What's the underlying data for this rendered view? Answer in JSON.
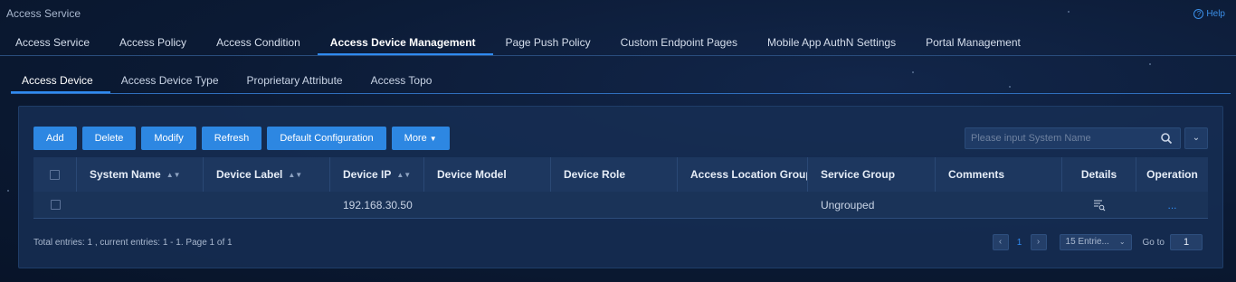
{
  "app": {
    "title": "Access Service",
    "help_label": "Help"
  },
  "main_tabs": [
    {
      "label": "Access Service"
    },
    {
      "label": "Access Policy"
    },
    {
      "label": "Access Condition"
    },
    {
      "label": "Access Device Management",
      "active": true
    },
    {
      "label": "Page Push Policy"
    },
    {
      "label": "Custom Endpoint Pages"
    },
    {
      "label": "Mobile App AuthN Settings"
    },
    {
      "label": "Portal Management"
    }
  ],
  "sub_tabs": [
    {
      "label": "Access Device",
      "active": true
    },
    {
      "label": "Access Device Type"
    },
    {
      "label": "Proprietary Attribute"
    },
    {
      "label": "Access Topo"
    }
  ],
  "toolbar": {
    "add": "Add",
    "delete": "Delete",
    "modify": "Modify",
    "refresh": "Refresh",
    "default_config": "Default Configuration",
    "more": "More"
  },
  "search": {
    "placeholder": "Please input System Name",
    "value": ""
  },
  "table": {
    "columns": [
      "System Name",
      "Device Label",
      "Device IP",
      "Device Model",
      "Device Role",
      "Access Location Group",
      "Service Group",
      "Comments",
      "Details",
      "Operation"
    ],
    "rows": [
      {
        "system_name": "",
        "device_label": "",
        "device_ip": "192.168.30.50",
        "device_model": "",
        "device_role": "",
        "access_location_group": "",
        "service_group": "Ungrouped",
        "comments": "",
        "operation": "..."
      }
    ]
  },
  "footer": {
    "summary": "Total entries: 1 , current entries: 1 - 1. Page 1 of 1",
    "current_page": "1",
    "page_size": "15 Entrie...",
    "goto_label": "Go to",
    "goto_value": "1"
  },
  "colors": {
    "accent": "#2f8af0",
    "button": "#2d87e2",
    "background": "#0b1a34"
  }
}
